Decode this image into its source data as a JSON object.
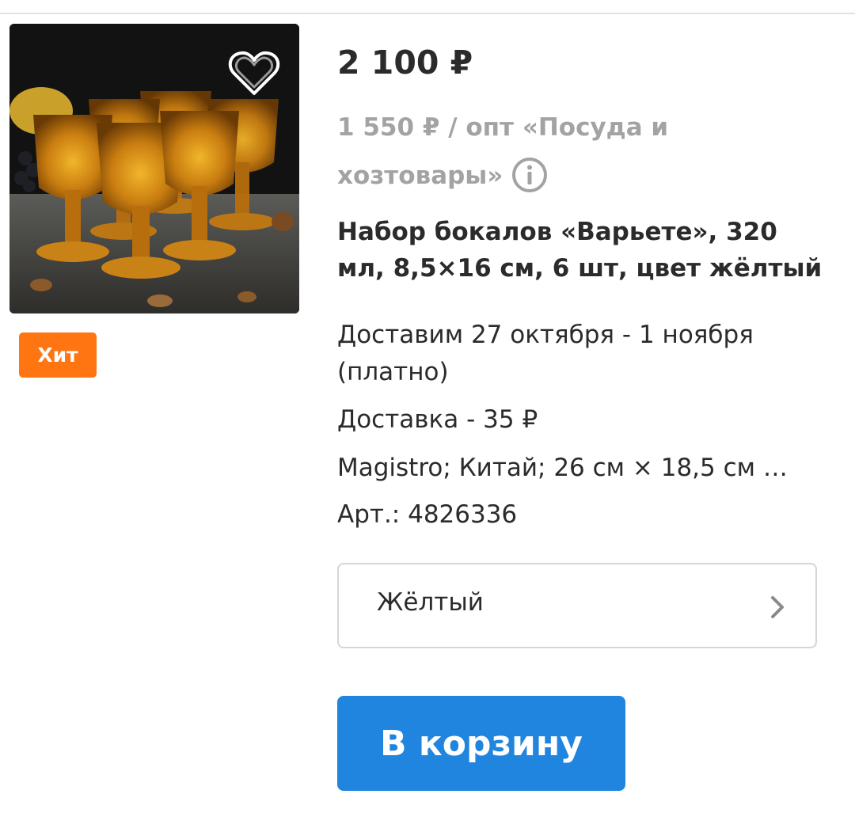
{
  "product": {
    "price": "2 100 ₽",
    "wholesale_text": "1 550 ₽ / опт «Посуда и хозтовары»",
    "title": "Набор бокалов «Варьете», 320 мл, 8,5×16 см, 6 шт, цвет жёлтый",
    "delivery_dates": "Доставим 27 октября - 1 ноября (платно)",
    "delivery_cost": "Доставка - 35 ₽",
    "specs": "Magistro; Китай; 26 см × 18,5 см …",
    "article": "Арт.: 4826336",
    "badge": "Хит"
  },
  "variant": {
    "selected": "Жёлтый"
  },
  "actions": {
    "cart_label": "В корзину"
  },
  "icons": {
    "favorite": "heart-outline-icon",
    "info": "info-circle-icon",
    "chevron": "chevron-right-icon"
  },
  "colors": {
    "badge": "#ff7512",
    "cart_button": "#1f85de",
    "muted_text": "#a3a3a3",
    "text": "#2b2b2b"
  }
}
